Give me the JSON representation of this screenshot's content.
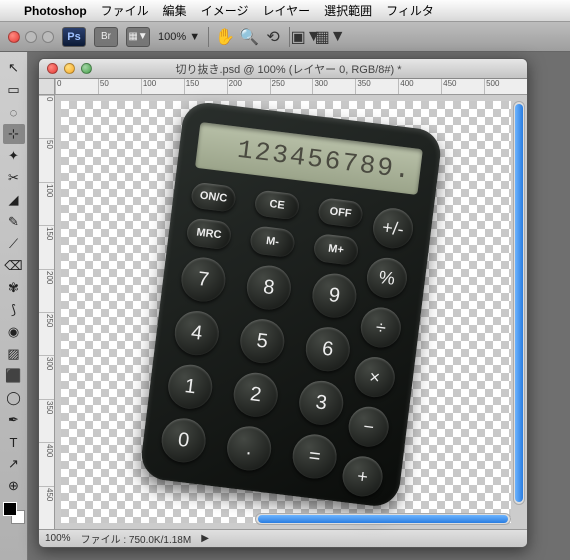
{
  "menubar": {
    "app": "Photoshop",
    "items": [
      "ファイル",
      "編集",
      "イメージ",
      "レイヤー",
      "選択範囲",
      "フィルタ"
    ]
  },
  "optbar": {
    "ps": "Ps",
    "br": "Br",
    "zoom": "100%",
    "dd": "▼"
  },
  "tools": [
    "↖",
    "▭",
    "◌",
    "⊹",
    "✦",
    "✂",
    "◢",
    "✎",
    "⟋",
    "⌫",
    "✾",
    "⟆",
    "◉",
    "▨",
    "⬛",
    "◯",
    "✒",
    "T",
    "↗",
    "⊕"
  ],
  "doc": {
    "title": "切り抜き.psd @ 100% (レイヤー 0, RGB/8#) *",
    "ruler_h": [
      "0",
      "50",
      "100",
      "150",
      "200",
      "250",
      "300",
      "350",
      "400",
      "450",
      "500"
    ],
    "ruler_v": [
      "0",
      "50",
      "100",
      "150",
      "200",
      "250",
      "300",
      "350",
      "400",
      "450"
    ],
    "status_zoom": "100%",
    "status_file": "ファイル : 750.0K/1.18M",
    "status_arrow": "▶"
  },
  "calc": {
    "display": "123456789.",
    "r1": [
      "ON/C",
      "CE",
      "OFF"
    ],
    "r2": [
      "MRC",
      "M-",
      "M+"
    ],
    "ops": [
      "+/-",
      "%",
      "÷",
      "×",
      "−",
      "+"
    ],
    "nums": [
      [
        "7",
        "8",
        "9"
      ],
      [
        "4",
        "5",
        "6"
      ],
      [
        "1",
        "2",
        "3"
      ],
      [
        "0",
        ".",
        "="
      ]
    ]
  }
}
